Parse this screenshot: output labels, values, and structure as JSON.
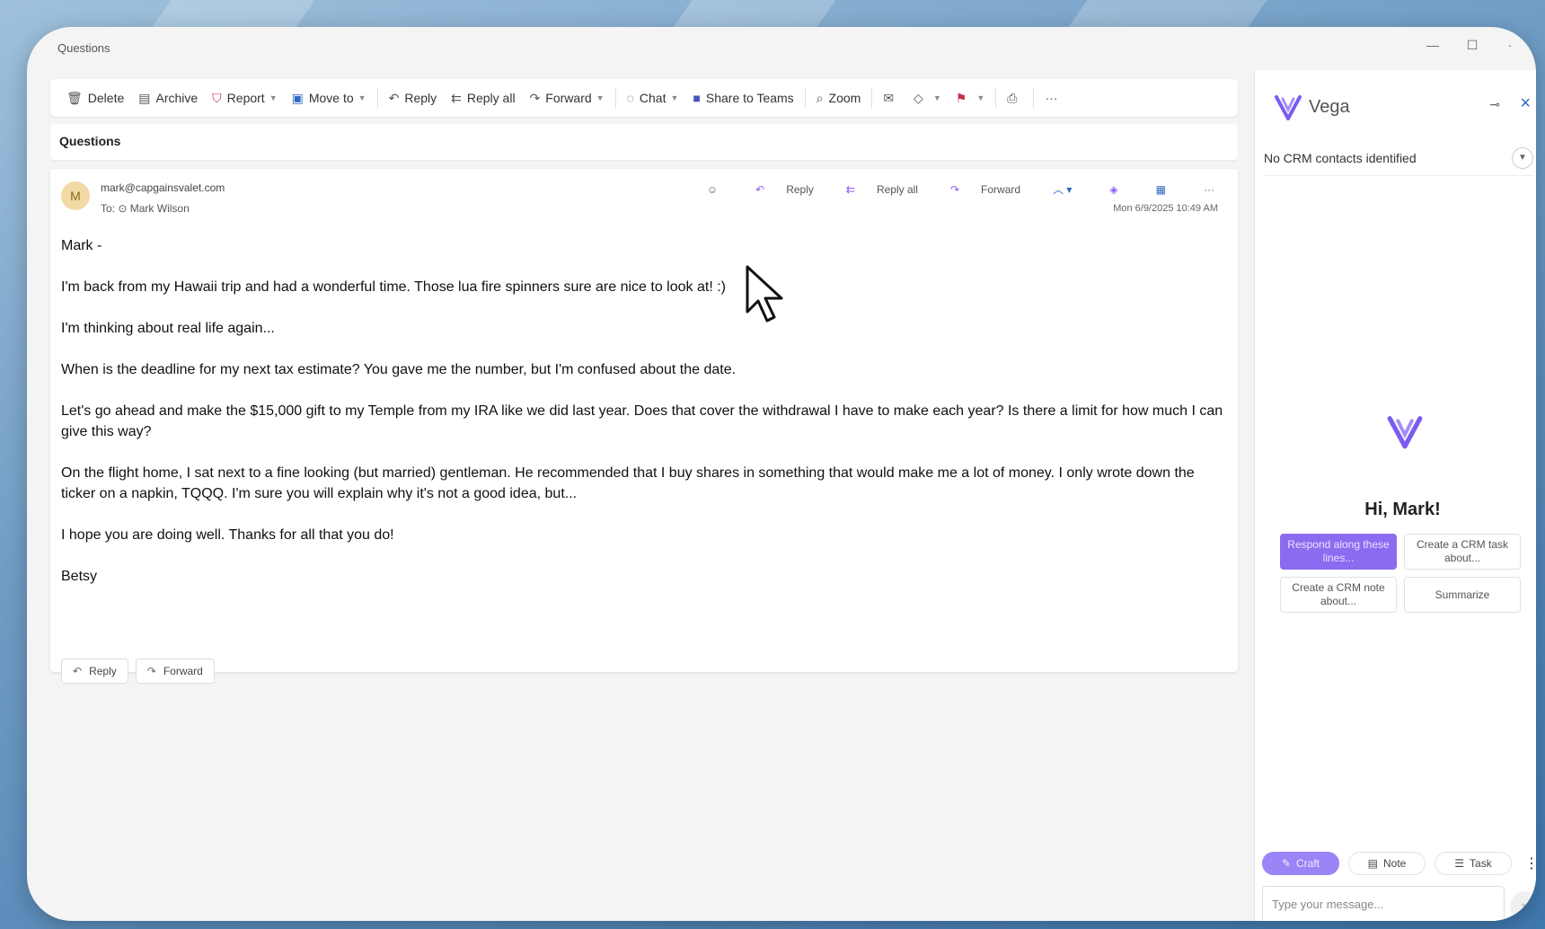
{
  "window": {
    "title": "Questions"
  },
  "toolbar": {
    "delete": "Delete",
    "archive": "Archive",
    "report": "Report",
    "move_to": "Move to",
    "reply": "Reply",
    "reply_all": "Reply all",
    "forward": "Forward",
    "chat": "Chat",
    "share_to_teams": "Share to Teams",
    "zoom": "Zoom"
  },
  "subject": "Questions",
  "message": {
    "avatar_initial": "M",
    "from": "mark@capgainsvalet.com",
    "to_label": "To:",
    "to_name": "Mark Wilson",
    "actions": {
      "reply": "Reply",
      "reply_all": "Reply all",
      "forward": "Forward"
    },
    "date": "Mon 6/9/2025 10:49 AM",
    "body": [
      "Mark -",
      "I'm back from my Hawaii trip and had a wonderful time. Those lua fire spinners sure are nice to look at! :)",
      "I'm thinking about real life again...",
      "When is the deadline for my next tax estimate? You gave me the number, but I'm confused about the date.",
      "Let's go ahead and make the $15,000 gift to my Temple from my IRA like we did last year. Does that cover the withdrawal I have to make each year? Is there a limit for how much I can give this way?",
      "On the flight home, I sat next to a fine looking (but married) gentleman. He recommended that I buy shares in something that would make me a lot of money. I only wrote down the ticker on a napkin, TQQQ. I'm sure you will explain why it's not a good idea, but...",
      "I hope you are doing well. Thanks for all that you do!",
      "Betsy"
    ],
    "footer": {
      "reply": "Reply",
      "forward": "Forward"
    }
  },
  "vega": {
    "title": "Vega",
    "crm_status": "No CRM contacts identified",
    "greeting": "Hi, Mark!",
    "suggestions": {
      "respond": "Respond along these lines...",
      "crm_task": "Create a CRM task about...",
      "crm_note": "Create a CRM note about...",
      "summarize": "Summarize"
    },
    "modes": {
      "craft": "Craft",
      "note": "Note",
      "task": "Task"
    },
    "input_placeholder": "Type your message...",
    "accent_color": "#8b6cf0"
  }
}
